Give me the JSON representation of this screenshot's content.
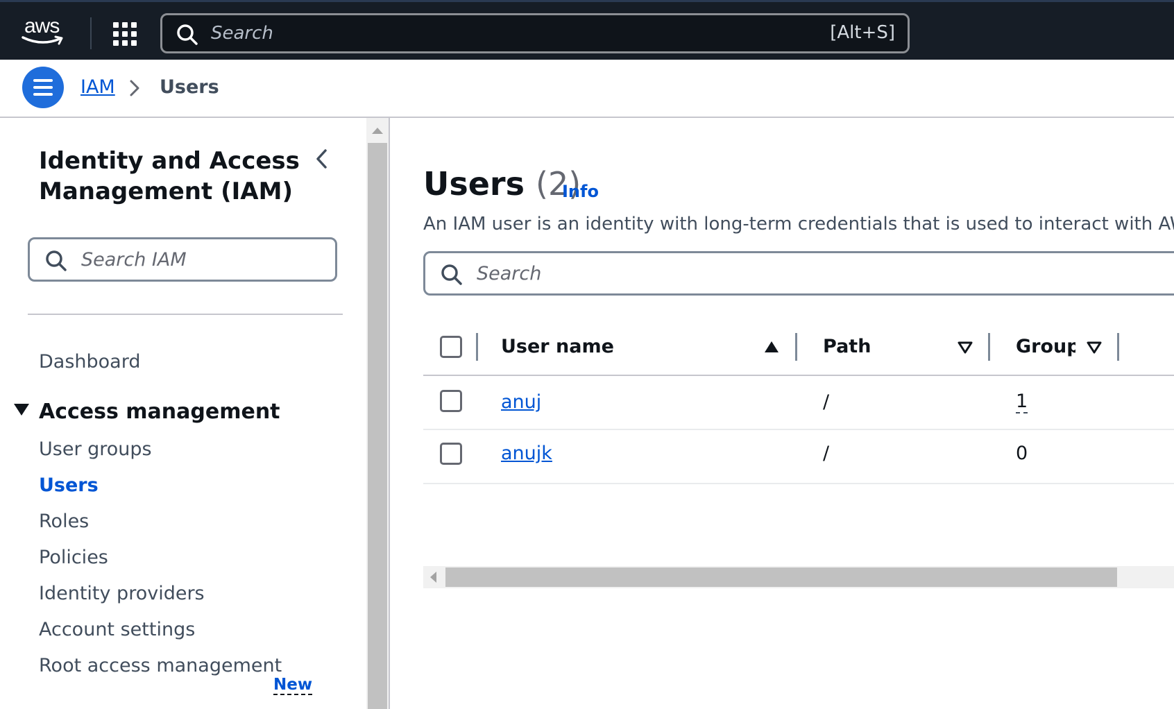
{
  "topnav": {
    "logo_text": "aws",
    "search_placeholder": "Search",
    "search_shortcut": "[Alt+S]"
  },
  "breadcrumb": {
    "items": [
      "IAM",
      "Users"
    ]
  },
  "sidebar": {
    "title": "Identity and Access Management (IAM)",
    "search_placeholder": "Search IAM",
    "dashboard": "Dashboard",
    "section_label": "Access management",
    "items": [
      {
        "label": "User groups",
        "active": false
      },
      {
        "label": "Users",
        "active": true
      },
      {
        "label": "Roles",
        "active": false
      },
      {
        "label": "Policies",
        "active": false
      },
      {
        "label": "Identity providers",
        "active": false
      },
      {
        "label": "Account settings",
        "active": false
      },
      {
        "label": "Root access management",
        "active": false
      }
    ],
    "new_badge": "New"
  },
  "main": {
    "title": "Users",
    "count": "(2)",
    "info_label": "Info",
    "description": "An IAM user is an identity with long-term credentials that is used to interact with AWS",
    "search_placeholder": "Search",
    "table": {
      "columns": [
        "User name",
        "Path",
        "Groups"
      ],
      "rows": [
        {
          "user_name": "anuj",
          "path": "/",
          "groups": "1"
        },
        {
          "user_name": "anujk",
          "path": "/",
          "groups": "0"
        }
      ]
    }
  },
  "colors": {
    "nav_bg": "#161d26",
    "accent_blue": "#0055d4",
    "menu_button": "#1f6ddb"
  }
}
